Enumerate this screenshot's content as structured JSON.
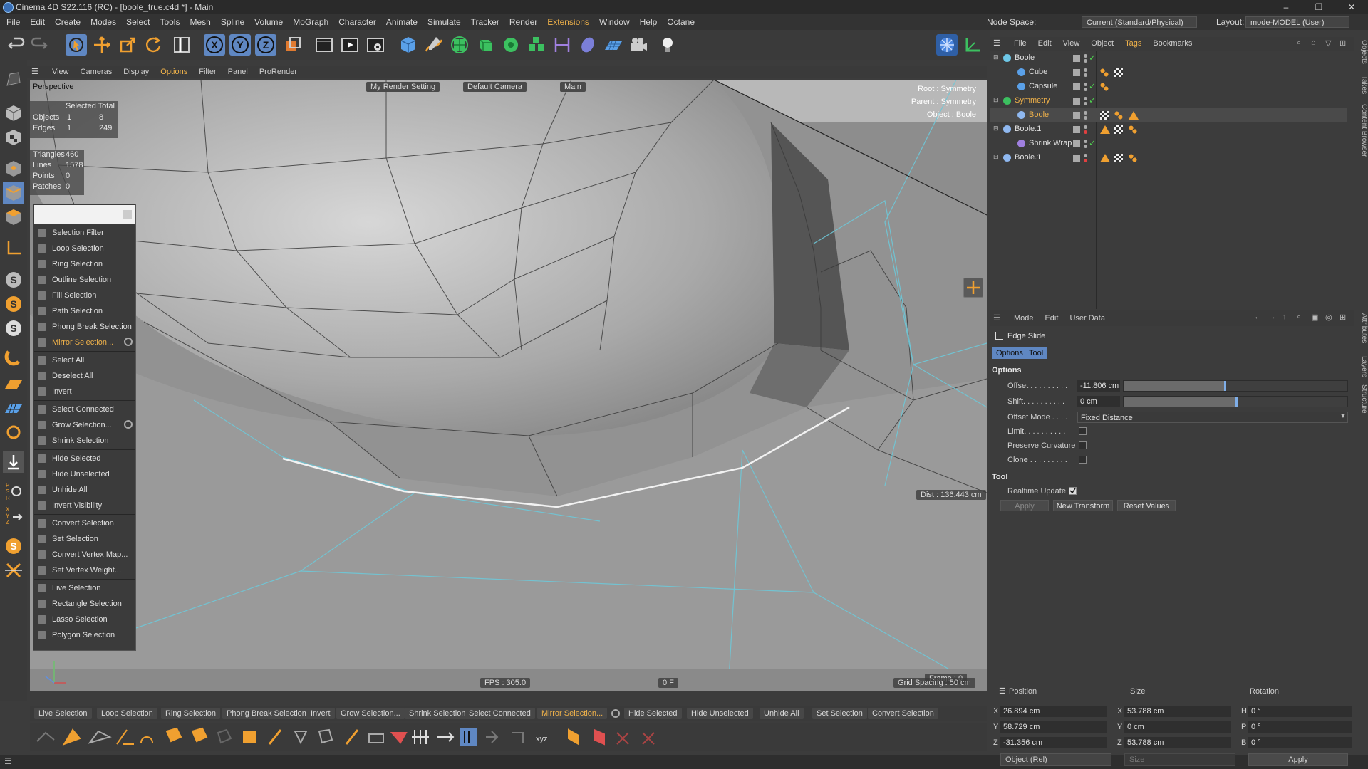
{
  "window": {
    "title": "Cinema 4D S22.116 (RC) - [boole_true.c4d *] - Main",
    "controls": [
      "–",
      "❐",
      "✕"
    ]
  },
  "menubar": {
    "items": [
      "File",
      "Edit",
      "Create",
      "Modes",
      "Select",
      "Tools",
      "Mesh",
      "Spline",
      "Volume",
      "MoGraph",
      "Character",
      "Animate",
      "Simulate",
      "Tracker",
      "Render",
      "Extensions",
      "Window",
      "Help",
      "Octane"
    ],
    "highlight_index": 15,
    "node_space_label": "Node Space:",
    "node_space_value": "Current (Standard/Physical)",
    "layout_label": "Layout:",
    "layout_value": "mode-MODEL (User)"
  },
  "viewport_menu": {
    "items": [
      "View",
      "Cameras",
      "Display",
      "Options",
      "Filter",
      "Panel",
      "ProRender"
    ],
    "highlight_index": 3
  },
  "viewport": {
    "label": "Perspective",
    "render_setting": "My Render Setting",
    "camera": "Default Camera",
    "take": "Main",
    "root": "Root : Symmetry",
    "parent": "Parent : Symmetry",
    "object": "Object : Boole",
    "selected_header": "Selected Total",
    "objects_label": "Objects",
    "objects_sel": "1",
    "objects_total": "8",
    "edges_label": "Edges",
    "edges_sel": "1",
    "edges_total": "249",
    "triangles_label": "Triangles",
    "triangles": "460",
    "lines_label": "Lines",
    "lines": "1578",
    "points_label": "Points",
    "points": "0",
    "patches_label": "Patches",
    "patches": "0",
    "dist": "Dist : 136.443 cm",
    "fps": "FPS : 305.0",
    "frame_marker": "0 F",
    "frame": "Frame : 0",
    "grid_spacing": "Grid Spacing : 50 cm"
  },
  "popup_menu": [
    {
      "label": "Selection Filter",
      "hl": false,
      "gear": false
    },
    {
      "label": "Loop Selection",
      "hl": false,
      "gear": false
    },
    {
      "label": "Ring Selection",
      "hl": false,
      "gear": false
    },
    {
      "label": "Outline Selection",
      "hl": false,
      "gear": false
    },
    {
      "label": "Fill Selection",
      "hl": false,
      "gear": false
    },
    {
      "label": "Path Selection",
      "hl": false,
      "gear": false
    },
    {
      "label": "Phong Break Selection",
      "hl": false,
      "gear": false
    },
    {
      "label": "Mirror Selection...",
      "hl": true,
      "gear": true
    },
    {
      "label": "Select All",
      "hl": false,
      "gear": false
    },
    {
      "label": "Deselect All",
      "hl": false,
      "gear": false
    },
    {
      "label": "Invert",
      "hl": false,
      "gear": false
    },
    {
      "label": "Select Connected",
      "hl": false,
      "gear": false
    },
    {
      "label": "Grow Selection...",
      "hl": false,
      "gear": true
    },
    {
      "label": "Shrink Selection",
      "hl": false,
      "gear": false
    },
    {
      "label": "Hide Selected",
      "hl": false,
      "gear": false
    },
    {
      "label": "Hide Unselected",
      "hl": false,
      "gear": false
    },
    {
      "label": "Unhide All",
      "hl": false,
      "gear": false
    },
    {
      "label": "Invert Visibility",
      "hl": false,
      "gear": false
    },
    {
      "label": "Convert Selection",
      "hl": false,
      "gear": false
    },
    {
      "label": "Set Selection",
      "hl": false,
      "gear": false
    },
    {
      "label": "Convert Vertex Map...",
      "hl": false,
      "gear": false
    },
    {
      "label": "Set Vertex Weight...",
      "hl": false,
      "gear": false
    },
    {
      "label": "Live Selection",
      "hl": false,
      "gear": false
    },
    {
      "label": "Rectangle Selection",
      "hl": false,
      "gear": false
    },
    {
      "label": "Lasso Selection",
      "hl": false,
      "gear": false
    },
    {
      "label": "Polygon Selection",
      "hl": false,
      "gear": false
    }
  ],
  "bottom_commands": [
    {
      "label": "Live Selection",
      "hl": false
    },
    {
      "label": "Loop Selection",
      "hl": false
    },
    {
      "label": "Ring Selection",
      "hl": false
    },
    {
      "label": "Phong Break Selection",
      "hl": false
    },
    {
      "label": "Invert",
      "hl": false
    },
    {
      "label": "Grow Selection...",
      "hl": false
    },
    {
      "label": "Shrink Selection",
      "hl": false
    },
    {
      "label": "Select Connected",
      "hl": false
    },
    {
      "label": "Mirror Selection...",
      "hl": true
    },
    {
      "label": "Hide Selected",
      "hl": false
    },
    {
      "label": "Hide Unselected",
      "hl": false
    },
    {
      "label": "Unhide All",
      "hl": false
    },
    {
      "label": "Set Selection",
      "hl": false
    },
    {
      "label": "Convert Selection",
      "hl": false
    }
  ],
  "object_manager": {
    "menu": [
      "File",
      "Edit",
      "View",
      "Object",
      "Tags",
      "Bookmarks"
    ],
    "menu_highlight_index": 4,
    "objects": [
      {
        "name": "Boole",
        "indent": 0,
        "selected": false,
        "icon": "boole-icon"
      },
      {
        "name": "Cube",
        "indent": 1,
        "selected": false,
        "icon": "cube-icon"
      },
      {
        "name": "Capsule",
        "indent": 1,
        "selected": false,
        "icon": "capsule-icon"
      },
      {
        "name": "Symmetry",
        "indent": 0,
        "selected": true,
        "icon": "symmetry-icon"
      },
      {
        "name": "Boole",
        "indent": 1,
        "selected": true,
        "icon": "polygon-object-icon"
      },
      {
        "name": "Boole.1",
        "indent": 0,
        "selected": false,
        "icon": "polygon-object-icon"
      },
      {
        "name": "Shrink Wrap",
        "indent": 1,
        "selected": false,
        "icon": "shrink-wrap-icon"
      },
      {
        "name": "Boole.1",
        "indent": 0,
        "selected": false,
        "icon": "polygon-object-icon"
      }
    ]
  },
  "attributes": {
    "menu": [
      "Mode",
      "Edit",
      "User Data"
    ],
    "tool_name": "Edge Slide",
    "tabs": [
      "Options",
      "Tool"
    ],
    "options_header": "Options",
    "offset_label": "Offset . . . . . . . . .",
    "offset_value": "-11.806 cm",
    "offset_fraction": 0.45,
    "shift_label": "Shift. . . . . . . . . .",
    "shift_value": "0 cm",
    "shift_fraction": 0.5,
    "offset_mode_label": "Offset Mode . . . .",
    "offset_mode_value": "Fixed Distance",
    "limit_label": "Limit. . . . . . . . . .",
    "preserve_label": "Preserve Curvature",
    "clone_label": "Clone . . . . . . . . .",
    "tool_header": "Tool",
    "realtime_label": "Realtime Update",
    "apply_label": "Apply",
    "new_transform_label": "New Transform",
    "reset_label": "Reset Values"
  },
  "coordinates": {
    "position_label": "Position",
    "size_label": "Size",
    "rotation_label": "Rotation",
    "x_label": "X",
    "y_label": "Y",
    "z_label": "Z",
    "h_label": "H",
    "p_label": "P",
    "b_label": "B",
    "pos_x": "26.894 cm",
    "pos_y": "58.729 cm",
    "pos_z": "-31.356 cm",
    "size_x": "53.788 cm",
    "size_y": "0 cm",
    "size_z": "53.788 cm",
    "rot_h": "0 °",
    "rot_p": "0 °",
    "rot_b": "0 °",
    "coord_mode": "Object (Rel)",
    "size_mode": "Size",
    "apply_label": "Apply"
  },
  "side_tabs": [
    "Objects",
    "Takes",
    "Content Browser",
    "Attributes",
    "Layers",
    "Structure"
  ]
}
